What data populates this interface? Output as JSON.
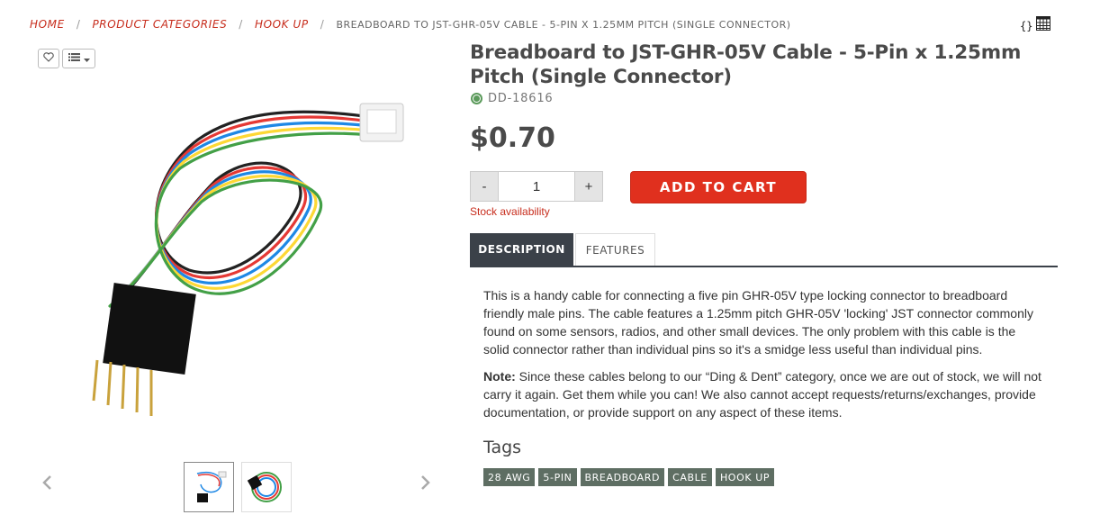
{
  "breadcrumb": {
    "home": "HOME",
    "categories": "PRODUCT CATEGORIES",
    "hookup": "HOOK UP",
    "current": "BREADBOARD TO JST-GHR-05V CABLE - 5-PIN X 1.25MM PITCH (SINGLE CONNECTOR)",
    "separator": "/"
  },
  "toolbar": {
    "braces": "{}"
  },
  "product": {
    "title": "Breadboard to JST-GHR-05V Cable - 5-Pin x 1.25mm Pitch (Single Connector)",
    "sku": "DD-18616",
    "price": "$0.70",
    "quantity": "1",
    "minus_label": "-",
    "plus_label": "+",
    "add_to_cart": "ADD TO CART",
    "stock_link": "Stock availability"
  },
  "tabs": [
    {
      "label": "DESCRIPTION"
    },
    {
      "label": "FEATURES"
    }
  ],
  "description": {
    "paragraph1": "This is a handy cable for connecting a five pin GHR-05V type locking connector to breadboard friendly male pins. The cable features a 1.25mm pitch GHR-05V 'locking' JST connector commonly found on some sensors, radios, and other small devices. The only problem with this cable is the solid connector rather than individual pins so it's a smidge less useful than individual pins.",
    "note_label": "Note:",
    "note_text": " Since these cables belong to our “Ding & Dent” category, once we are out of stock, we will not carry it again. Get them while you can! We also cannot accept requests/returns/exchanges, provide documentation, or provide support on any aspect of these items."
  },
  "tags": {
    "heading": "Tags",
    "items": [
      "28 AWG",
      "5-PIN",
      "BREADBOARD",
      "CABLE",
      "HOOK UP"
    ]
  },
  "colors": {
    "accent_red": "#e0301e",
    "link_red": "#c72c1c",
    "tab_dark": "#3b4149",
    "tag_green": "#5e6e63",
    "status_green": "#5b9a5b"
  },
  "icons": [
    "heart-icon",
    "list-icon",
    "braces-icon",
    "grid-icon",
    "chevron-left-icon",
    "chevron-right-icon",
    "status-dot-icon"
  ]
}
